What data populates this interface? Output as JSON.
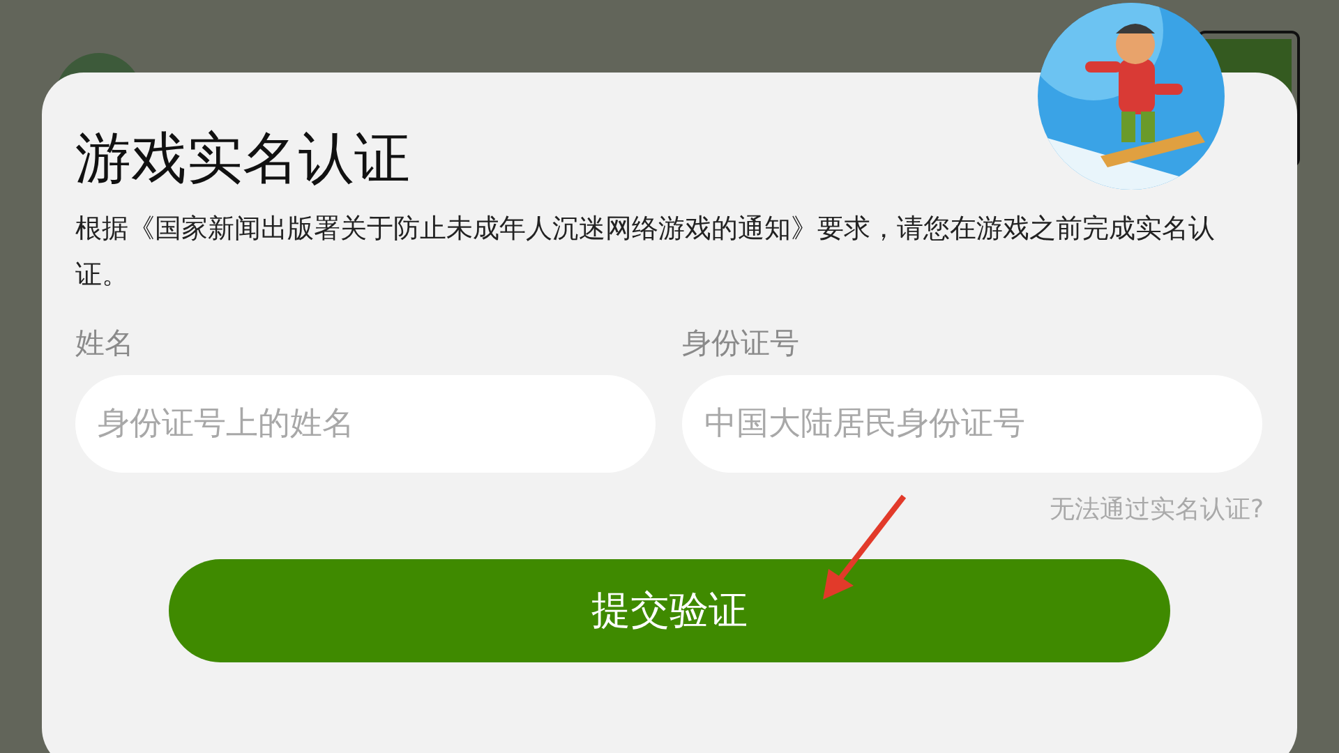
{
  "dialog": {
    "title": "游戏实名认证",
    "description": "根据《国家新闻出版署关于防止未成年人沉迷网络游戏的通知》要求，请您在游戏之前完成实名认证。",
    "fields": [
      {
        "label": "姓名",
        "placeholder": "身份证号上的姓名"
      },
      {
        "label": "身份证号",
        "placeholder": "中国大陆居民身份证号"
      }
    ],
    "help_link": "无法通过实名认证?",
    "submit_button": "提交验证"
  }
}
